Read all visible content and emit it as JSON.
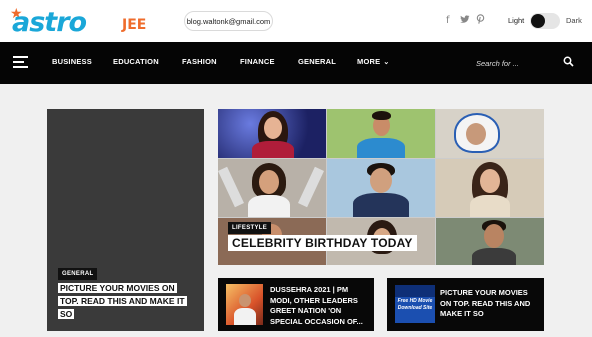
{
  "header": {
    "logo_main": "astro",
    "logo_sub": "JEE",
    "email": "blog.waltonk@gmail.com",
    "social_icons": [
      "facebook-icon",
      "twitter-icon",
      "pinterest-icon"
    ],
    "mode_light": "Light",
    "mode_dark": "Dark"
  },
  "nav": {
    "items": [
      "BUSINESS",
      "EDUCATION",
      "FASHION",
      "FINANCE",
      "GENERAL",
      "MORE"
    ],
    "search_placeholder": "Search for ..."
  },
  "feature_left": {
    "category": "GENERAL",
    "title": "PICTURE YOUR MOVIES ON TOP. READ THIS AND MAKE IT SO"
  },
  "feature_main": {
    "category": "LIFESTYLE",
    "title": "CELEBRITY BIRTHDAY TODAY"
  },
  "cards": [
    {
      "title": "DUSSEHRA 2021 | PM MODI, OTHER LEADERS GREET NATION 'ON SPECIAL OCCASION OF..."
    },
    {
      "title": "PICTURE YOUR MOVIES ON TOP. READ THIS AND MAKE IT SO",
      "thumb_text": "Free HD Movie Download Site"
    }
  ],
  "colors": {
    "brand_blue": "#1aa7d8",
    "brand_orange": "#ef6c2c",
    "nav_bg": "#050505"
  }
}
